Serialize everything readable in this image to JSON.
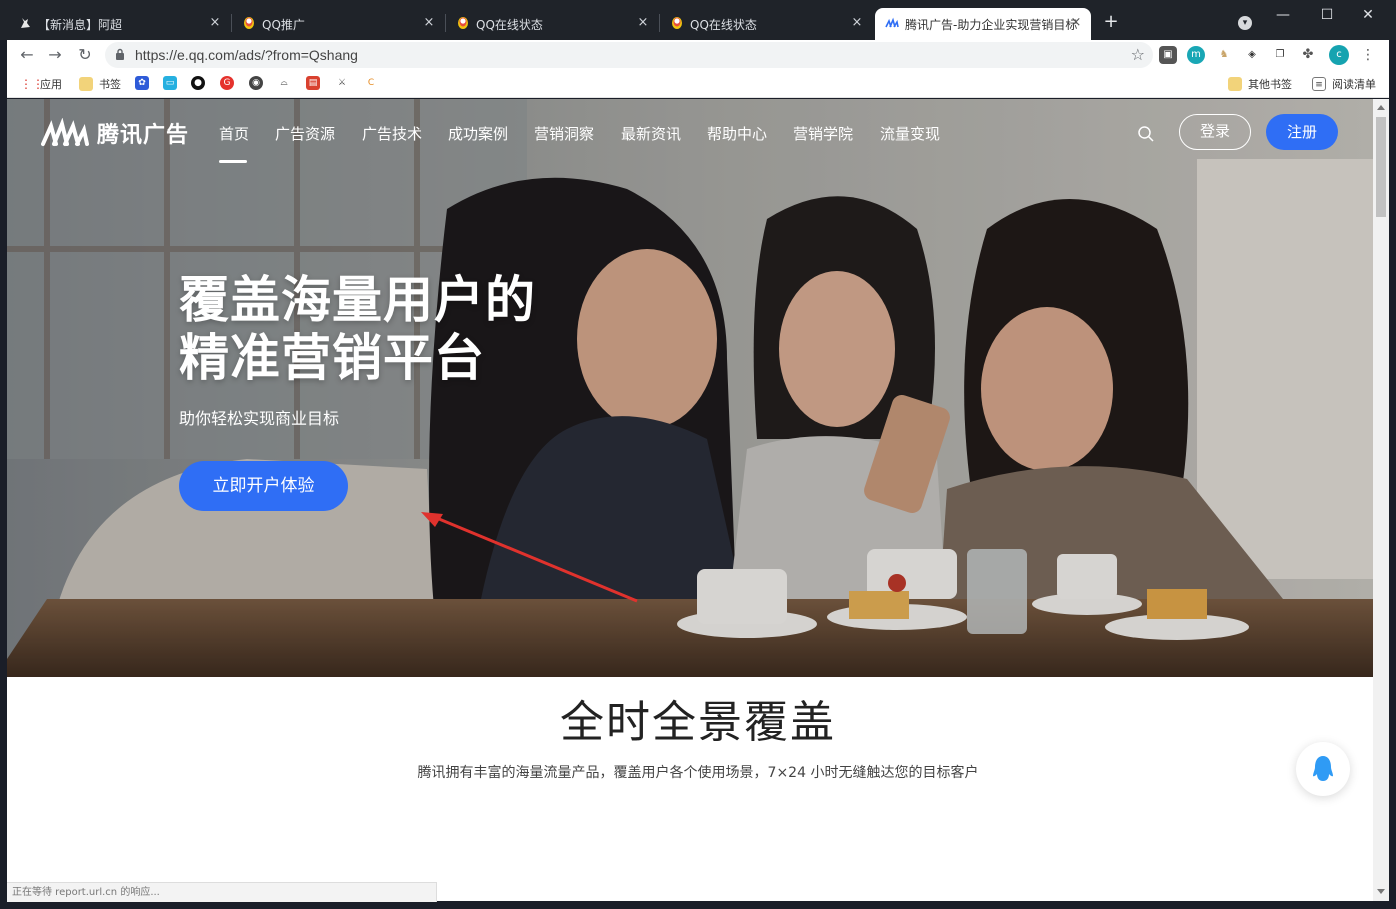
{
  "browser": {
    "tabs": [
      {
        "title": "【新消息】阿超",
        "active": false
      },
      {
        "title": "QQ推广",
        "active": false
      },
      {
        "title": "QQ在线状态",
        "active": false
      },
      {
        "title": "QQ在线状态",
        "active": false
      },
      {
        "title": "腾讯广告-助力企业实现营销目标",
        "active": true
      }
    ],
    "new_tab": "+",
    "close_glyph": "×",
    "window": {
      "minimize": "—",
      "maximize": "☐",
      "close": "✕"
    },
    "url": "https://e.qq.com/ads/?from=Qshang",
    "profile_initial": "c",
    "bookmarks": {
      "apps": "应用",
      "bookmarks_folder": "书签",
      "other_bookmarks": "其他书签",
      "reading_list": "阅读清单"
    }
  },
  "site": {
    "logo_text": "腾讯广告",
    "nav": [
      "首页",
      "广告资源",
      "广告技术",
      "成功案例",
      "营销洞察",
      "最新资讯",
      "帮助中心",
      "营销学院",
      "流量变现"
    ],
    "login_label": "登录",
    "register_label": "注册"
  },
  "hero": {
    "title_line1": "覆盖海量用户的",
    "title_line2": "精准营销平台",
    "subtitle": "助你轻松实现商业目标",
    "cta_label": "立即开户体验"
  },
  "section": {
    "title": "全时全景覆盖",
    "subtitle": "腾讯拥有丰富的海量流量产品，覆盖用户各个使用场景，7×24 小时无缝触达您的目标客户"
  },
  "status_text": "正在等待 report.url.cn 的响应...",
  "colors": {
    "accent": "#2f6ef5",
    "annotation_arrow": "#e0322d"
  }
}
